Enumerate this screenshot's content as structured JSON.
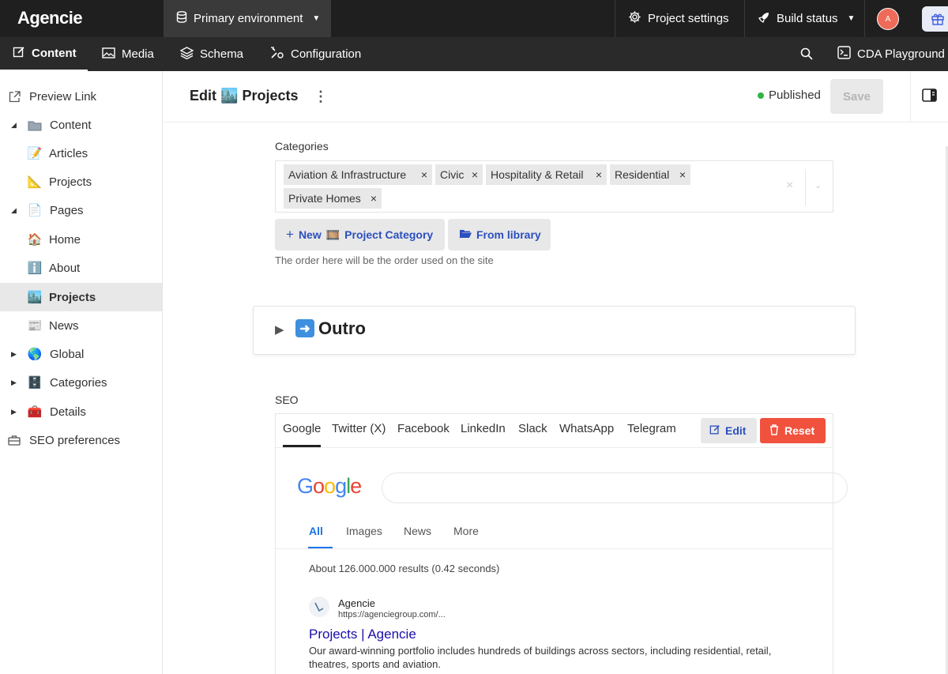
{
  "app": {
    "logo": "Agencie"
  },
  "topbar": {
    "environment": "Primary environment",
    "project_settings": "Project settings",
    "build_status": "Build status",
    "avatar_initial": "A"
  },
  "navbar": {
    "tabs": [
      {
        "label": "Content",
        "icon": "edit-icon"
      },
      {
        "label": "Media",
        "icon": "image-icon"
      },
      {
        "label": "Schema",
        "icon": "layers-icon"
      },
      {
        "label": "Configuration",
        "icon": "config-icon"
      }
    ],
    "cda_playground": "CDA Playground"
  },
  "sidebar": {
    "items": [
      {
        "label": "Preview Link",
        "icon": "external-link-icon"
      },
      {
        "label": "Content",
        "icon": "folder-icon"
      },
      {
        "label": "Articles",
        "icon": "memo-emoji-icon"
      },
      {
        "label": "Projects",
        "icon": "triangle-ruler-emoji-icon"
      },
      {
        "label": "Pages",
        "icon": "page-emoji-icon"
      },
      {
        "label": "Home",
        "icon": "house-emoji-icon"
      },
      {
        "label": "About",
        "icon": "info-emoji-icon"
      },
      {
        "label": "Projects",
        "icon": "cityscape-emoji-icon"
      },
      {
        "label": "News",
        "icon": "newspaper-emoji-icon"
      },
      {
        "label": "Global",
        "icon": "globe-emoji-icon"
      },
      {
        "label": "Categories",
        "icon": "cabinet-emoji-icon"
      },
      {
        "label": "Details",
        "icon": "toolbox-emoji-icon"
      },
      {
        "label": "SEO preferences",
        "icon": "briefcase-icon"
      }
    ]
  },
  "header": {
    "edit_prefix": "Edit",
    "title": "Projects",
    "status": "Published",
    "save_label": "Save"
  },
  "categories": {
    "label": "Categories",
    "chips": [
      "Aviation & Infrastructure",
      "Civic",
      "Hospitality & Retail",
      "Residential",
      "Private Homes"
    ],
    "new_button_prefix": "New",
    "new_button_suffix": "Project Category",
    "library_button": "From library",
    "hint": "The order here will be the order used on the site"
  },
  "outro": {
    "title": "Outro"
  },
  "seo": {
    "label": "SEO",
    "tabs": [
      "Google",
      "Twitter (X)",
      "Facebook",
      "LinkedIn",
      "Slack",
      "WhatsApp",
      "Telegram"
    ],
    "edit_label": "Edit",
    "reset_label": "Reset",
    "google_preview": {
      "logo_letters": [
        "G",
        "o",
        "o",
        "g",
        "l",
        "e"
      ],
      "logo_colors": [
        "#4285F4",
        "#EA4335",
        "#FBBC05",
        "#4285F4",
        "#34A853",
        "#EA4335"
      ],
      "tabs": [
        "All",
        "Images",
        "News",
        "More"
      ],
      "results_count": "About 126.000.000 results (0.42 seconds)",
      "site_name": "Agencie",
      "site_url": "https://agenciegroup.com/...",
      "result_title": "Projects | Agencie",
      "result_desc": "Our award-winning portfolio includes hundreds of buildings across sectors, including residential, retail, theatres, sports and aviation."
    }
  }
}
